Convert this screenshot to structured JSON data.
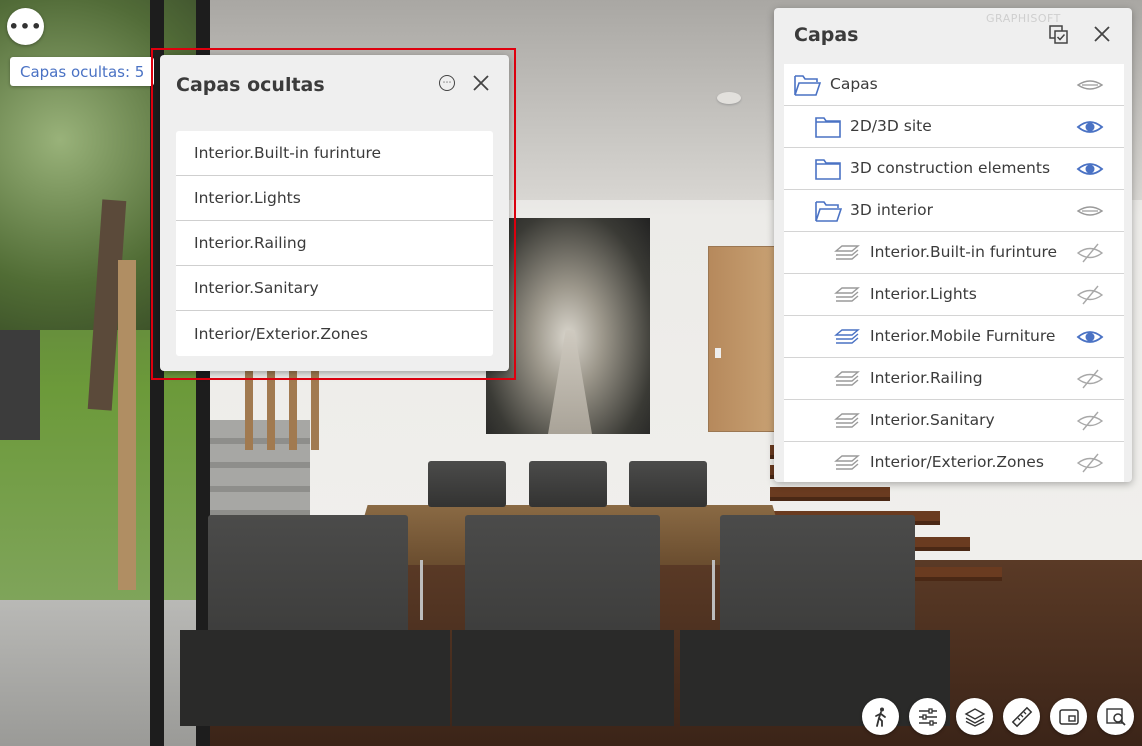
{
  "menu_button": {
    "label": "•••"
  },
  "hidden_badge": {
    "label": "Capas ocultas: 5"
  },
  "hidden_popup": {
    "title": "Capas ocultas",
    "items": [
      "Interior.Built-in furinture",
      "Interior.Lights",
      "Interior.Railing",
      "Interior.Sanitary",
      "Interior/Exterior.Zones"
    ]
  },
  "layers_panel": {
    "title": "Capas",
    "watermark": "GRAPHISOFT",
    "rows": [
      {
        "label": "Capas",
        "icon": "folder-open-icon",
        "level": 0,
        "visibility": "partial"
      },
      {
        "label": "2D/3D site",
        "icon": "folder-icon",
        "level": 1,
        "visibility": "visible"
      },
      {
        "label": "3D construction elements",
        "icon": "folder-icon",
        "level": 1,
        "visibility": "visible"
      },
      {
        "label": "3D interior",
        "icon": "folder-open-icon",
        "level": 1,
        "visibility": "partial"
      },
      {
        "label": "Interior.Built-in furinture",
        "icon": "layer-icon",
        "level": 2,
        "visibility": "hidden"
      },
      {
        "label": "Interior.Lights",
        "icon": "layer-icon",
        "level": 2,
        "visibility": "hidden"
      },
      {
        "label": "Interior.Mobile Furniture",
        "icon": "layer-icon",
        "level": 2,
        "visibility": "visible"
      },
      {
        "label": "Interior.Railing",
        "icon": "layer-icon",
        "level": 2,
        "visibility": "hidden"
      },
      {
        "label": "Interior.Sanitary",
        "icon": "layer-icon",
        "level": 2,
        "visibility": "hidden"
      },
      {
        "label": "Interior/Exterior.Zones",
        "icon": "layer-icon",
        "level": 2,
        "visibility": "hidden"
      }
    ]
  },
  "toolbar": {
    "buttons": [
      "walk-icon",
      "settings-sliders-icon",
      "layers-icon",
      "measure-ruler-icon",
      "minimap-icon",
      "zoom-search-icon"
    ]
  },
  "colors": {
    "accent": "#4a72c4",
    "highlight_outline": "#e0000f",
    "panel_bg": "#efefef",
    "text": "#3b3b3b"
  }
}
